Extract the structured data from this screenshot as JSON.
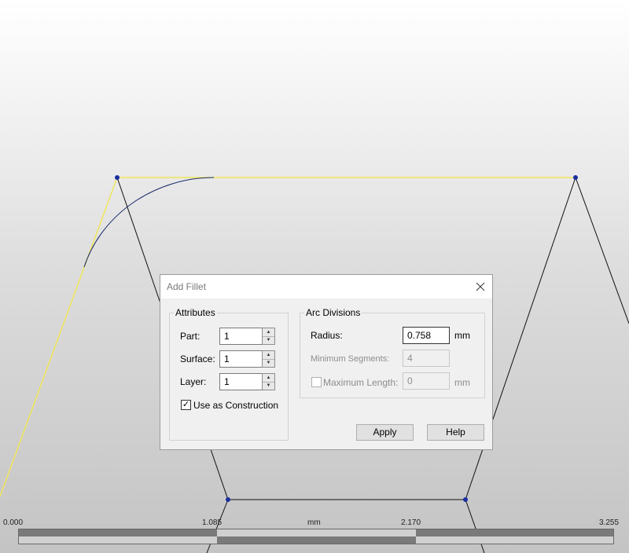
{
  "dialog": {
    "title": "Add Fillet",
    "attributes": {
      "group_label": "Attributes",
      "part_label": "Part:",
      "part_value": "1",
      "surface_label": "Surface:",
      "surface_value": "1",
      "layer_label": "Layer:",
      "layer_value": "1",
      "use_construction_label": "Use as Construction",
      "use_construction_checked": true
    },
    "arc_divisions": {
      "group_label": "Arc Divisions",
      "radius_label": "Radius:",
      "radius_value": "0.758",
      "radius_unit": "mm",
      "min_segments_label": "Minimum Segments:",
      "min_segments_value": "4",
      "max_length_label": "Maximum Length:",
      "max_length_value": "0",
      "max_length_unit": "mm",
      "max_length_checked": false
    },
    "apply_label": "Apply",
    "help_label": "Help"
  },
  "scale": {
    "unit": "mm",
    "tick_0": "0.000",
    "tick_1": "1.085",
    "tick_2": "2.170",
    "tick_3": "3.255"
  },
  "colors": {
    "highlight": "#f0e65a",
    "geometry": "#111111",
    "vertex": "#1a2fa0"
  },
  "icons": {
    "close": "close-icon",
    "spin_up": "spin-up-icon",
    "spin_down": "spin-down-icon",
    "check": "check-icon"
  }
}
